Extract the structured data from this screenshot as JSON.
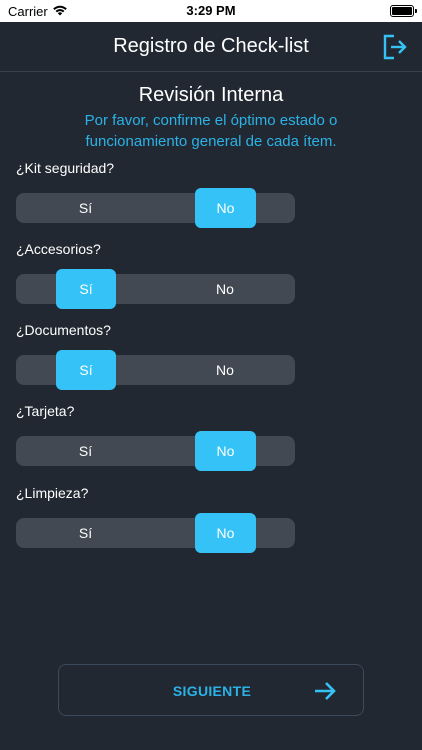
{
  "status_bar": {
    "carrier": "Carrier",
    "time": "3:29 PM"
  },
  "nav": {
    "title": "Registro de Check-list",
    "logout_icon": "logout-icon"
  },
  "section": {
    "title": "Revisión Interna",
    "instructions_line1": "Por favor, confirme el óptimo estado o",
    "instructions_line2": "funcionamiento general de cada ítem."
  },
  "questions": [
    {
      "label": "¿Kit seguridad?",
      "yes": "Sí",
      "no": "No",
      "selected": "No"
    },
    {
      "label": "¿Accesorios?",
      "yes": "Sí",
      "no": "No",
      "selected": "Sí"
    },
    {
      "label": "¿Documentos?",
      "yes": "Sí",
      "no": "No",
      "selected": "Sí"
    },
    {
      "label": "¿Tarjeta?",
      "yes": "Sí",
      "no": "No",
      "selected": "No"
    },
    {
      "label": "¿Limpieza?",
      "yes": "Sí",
      "no": "No",
      "selected": "No"
    }
  ],
  "footer": {
    "next_label": "SIGUIENTE",
    "next_icon": "arrow-right-icon"
  },
  "colors": {
    "background": "#222831",
    "accent": "#35c3f7",
    "accent_text": "#2bb2e6",
    "segment_bg": "#424952"
  }
}
